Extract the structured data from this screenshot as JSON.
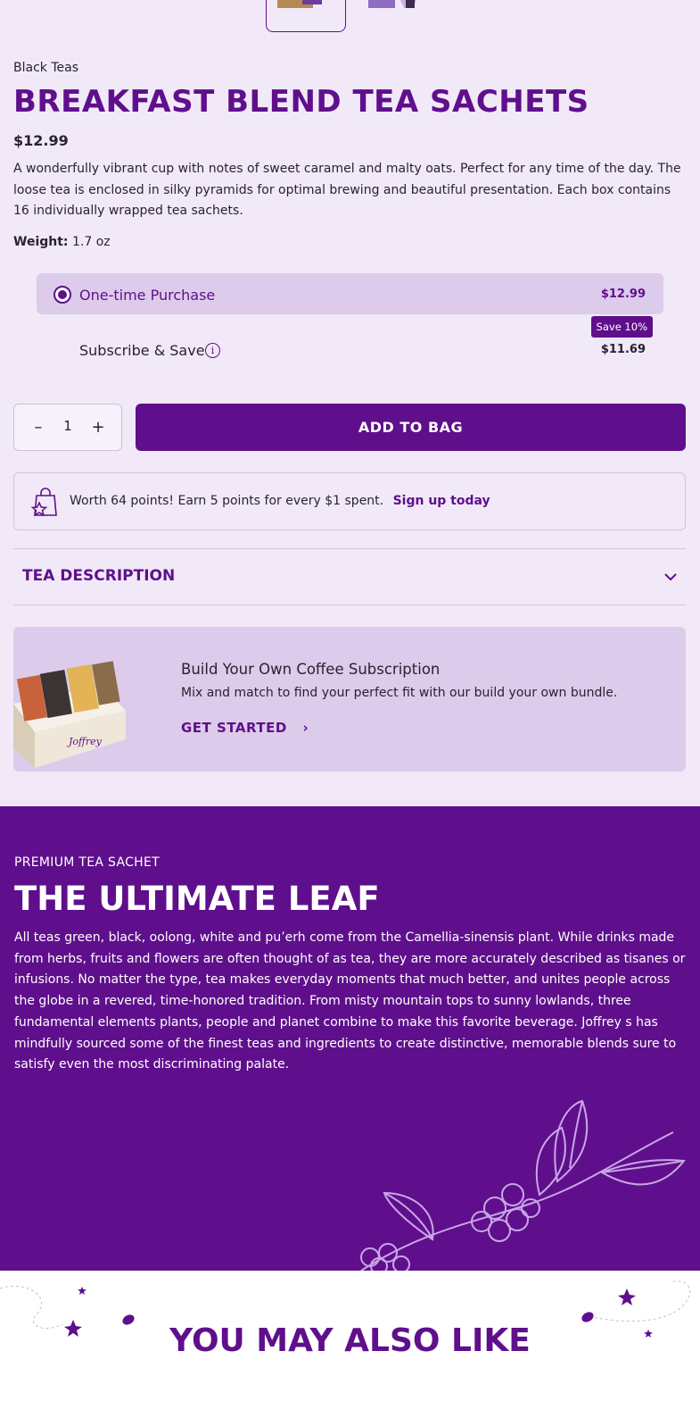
{
  "gallery": {
    "thumbnail_count": 2,
    "selected_index": 0
  },
  "product": {
    "category": "Black Teas",
    "title": "BREAKFAST BLEND TEA SACHETS",
    "price": "$12.99",
    "description": "A wonderfully vibrant cup with notes of sweet caramel and malty oats. Perfect for any time of the day. The loose tea is enclosed in silky pyramids for optimal brewing and beautiful presentation. Each box contains 16 individually wrapped tea sachets.",
    "weight_label": "Weight:",
    "weight_value": "1.7 oz"
  },
  "purchase_options": {
    "onetime": {
      "label": "One-time Purchase",
      "price": "$12.99",
      "selected": true
    },
    "subscribe": {
      "label": "Subscribe & Save",
      "price": "$11.69",
      "badge": "Save 10%",
      "info_icon": "i"
    }
  },
  "quantity": {
    "minus": "–",
    "value": "1",
    "plus": "+"
  },
  "add_to_bag": "ADD TO BAG",
  "rewards": {
    "text": "Worth 64 points! Earn 5 points for every $1 spent.",
    "link": "Sign up today"
  },
  "accordion": {
    "title": "TEA DESCRIPTION"
  },
  "promo": {
    "title": "Build Your Own Coffee Subscription",
    "subtitle": "Mix and match to find your perfect fit with our build your own bundle.",
    "cta": "GET STARTED",
    "cta_chevron": "›"
  },
  "leaf": {
    "eyebrow": "PREMIUM TEA SACHET",
    "title": "THE ULTIMATE LEAF",
    "body": "All teas green, black, oolong, white and pu’erh come from the Camellia-sinensis plant. While drinks made from herbs, fruits and flowers are often thought of as tea, they are more accurately described as tisanes or infusions. No matter the type, tea makes everyday moments that much better, and unites people across the globe in a revered, time-honored tradition. From misty mountain tops to sunny lowlands, three fundamental elements plants, people and planet combine to make this favorite beverage. Joffrey s has mindfully sourced some of the finest teas and ingredients to create distinctive, memorable blends sure to satisfy even the most discriminating palate."
  },
  "also_like": {
    "title": "YOU MAY ALSO LIKE"
  },
  "colors": {
    "brand": "#5f0f8c",
    "background": "#f1e9f7",
    "option_bg": "#dccbea",
    "text": "#2a2230"
  }
}
